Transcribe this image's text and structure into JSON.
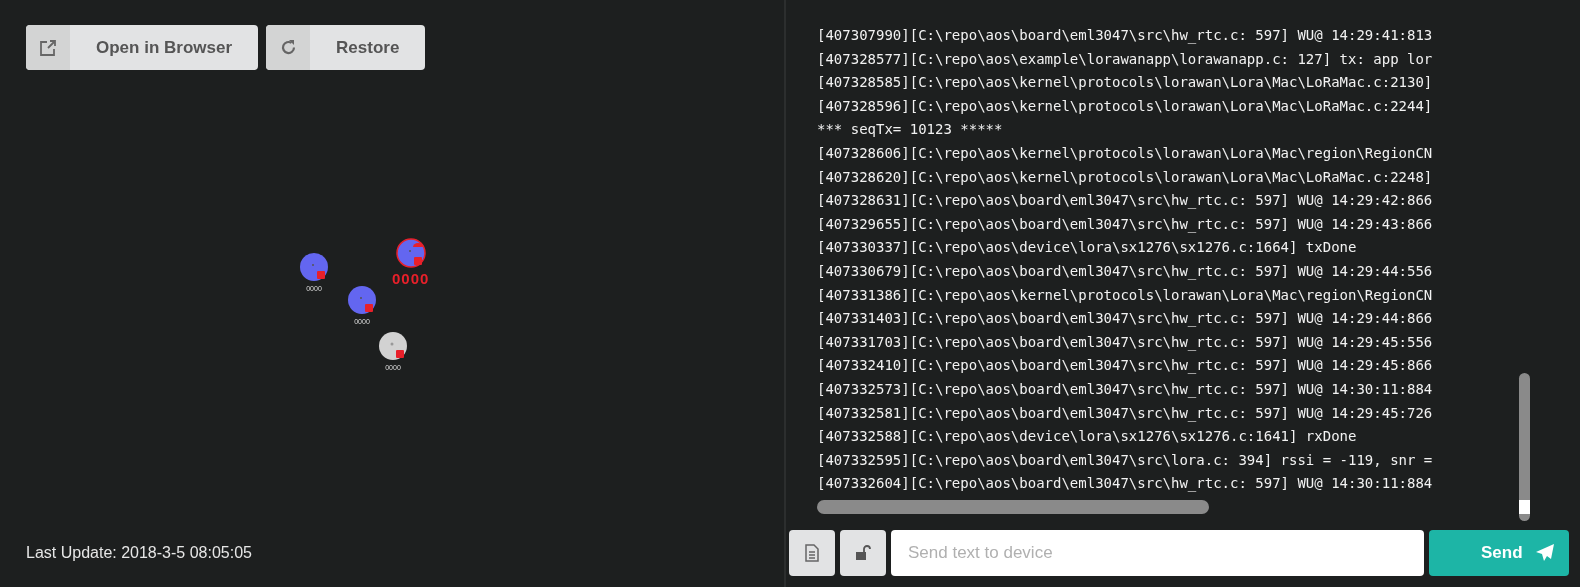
{
  "toolbar": {
    "buttons": [
      {
        "label": "Open in Browser",
        "kind": "open"
      },
      {
        "label": "Restore",
        "kind": "restore"
      }
    ]
  },
  "devices": [
    {
      "label": "0000",
      "kind": "online",
      "color": "#6366f0",
      "selected": false
    },
    {
      "label": "0000",
      "kind": "online",
      "color": "#6366f0",
      "selected": true
    },
    {
      "label": "0000",
      "kind": "online",
      "color": "#6366f0",
      "selected": false
    },
    {
      "label": "0000",
      "kind": "offline",
      "color": "#d2d2d2",
      "selected": false
    }
  ],
  "last_update": "Last Update: 2018-3-5 08:05:05",
  "log": [
    "[407307990][C:\\repo\\aos\\board\\eml3047\\src\\hw_rtc.c: 597] WU@ 14:29:41:813",
    "[407328577][C:\\repo\\aos\\example\\lorawanapp\\lorawanapp.c: 127] tx: app lor",
    "[407328585][C:\\repo\\aos\\kernel\\protocols\\lorawan\\Lora\\Mac\\LoRaMac.c:2130]",
    "[407328596][C:\\repo\\aos\\kernel\\protocols\\lorawan\\Lora\\Mac\\LoRaMac.c:2244]",
    "*** seqTx= 10123 *****",
    "[407328606][C:\\repo\\aos\\kernel\\protocols\\lorawan\\Lora\\Mac\\region\\RegionCN",
    "[407328620][C:\\repo\\aos\\kernel\\protocols\\lorawan\\Lora\\Mac\\LoRaMac.c:2248]",
    "[407328631][C:\\repo\\aos\\board\\eml3047\\src\\hw_rtc.c: 597] WU@ 14:29:42:866",
    "[407329655][C:\\repo\\aos\\board\\eml3047\\src\\hw_rtc.c: 597] WU@ 14:29:43:866",
    "[407330337][C:\\repo\\aos\\device\\lora\\sx1276\\sx1276.c:1664] txDone",
    "[407330679][C:\\repo\\aos\\board\\eml3047\\src\\hw_rtc.c: 597] WU@ 14:29:44:556",
    "[407331386][C:\\repo\\aos\\kernel\\protocols\\lorawan\\Lora\\Mac\\region\\RegionCN",
    "[407331403][C:\\repo\\aos\\board\\eml3047\\src\\hw_rtc.c: 597] WU@ 14:29:44:866",
    "[407331703][C:\\repo\\aos\\board\\eml3047\\src\\hw_rtc.c: 597] WU@ 14:29:45:556",
    "[407332410][C:\\repo\\aos\\board\\eml3047\\src\\hw_rtc.c: 597] WU@ 14:29:45:866",
    "[407332573][C:\\repo\\aos\\board\\eml3047\\src\\hw_rtc.c: 597] WU@ 14:30:11:884",
    "[407332581][C:\\repo\\aos\\board\\eml3047\\src\\hw_rtc.c: 597] WU@ 14:29:45:726",
    "[407332588][C:\\repo\\aos\\device\\lora\\sx1276\\sx1276.c:1641] rxDone",
    "[407332595][C:\\repo\\aos\\board\\eml3047\\src\\lora.c: 394] rssi = -119, snr =",
    "[407332604][C:\\repo\\aos\\board\\eml3047\\src\\hw_rtc.c: 597] WU@ 14:30:11:884"
  ],
  "input": {
    "placeholder": "Send text to device"
  },
  "send_button": {
    "label": "Send"
  }
}
